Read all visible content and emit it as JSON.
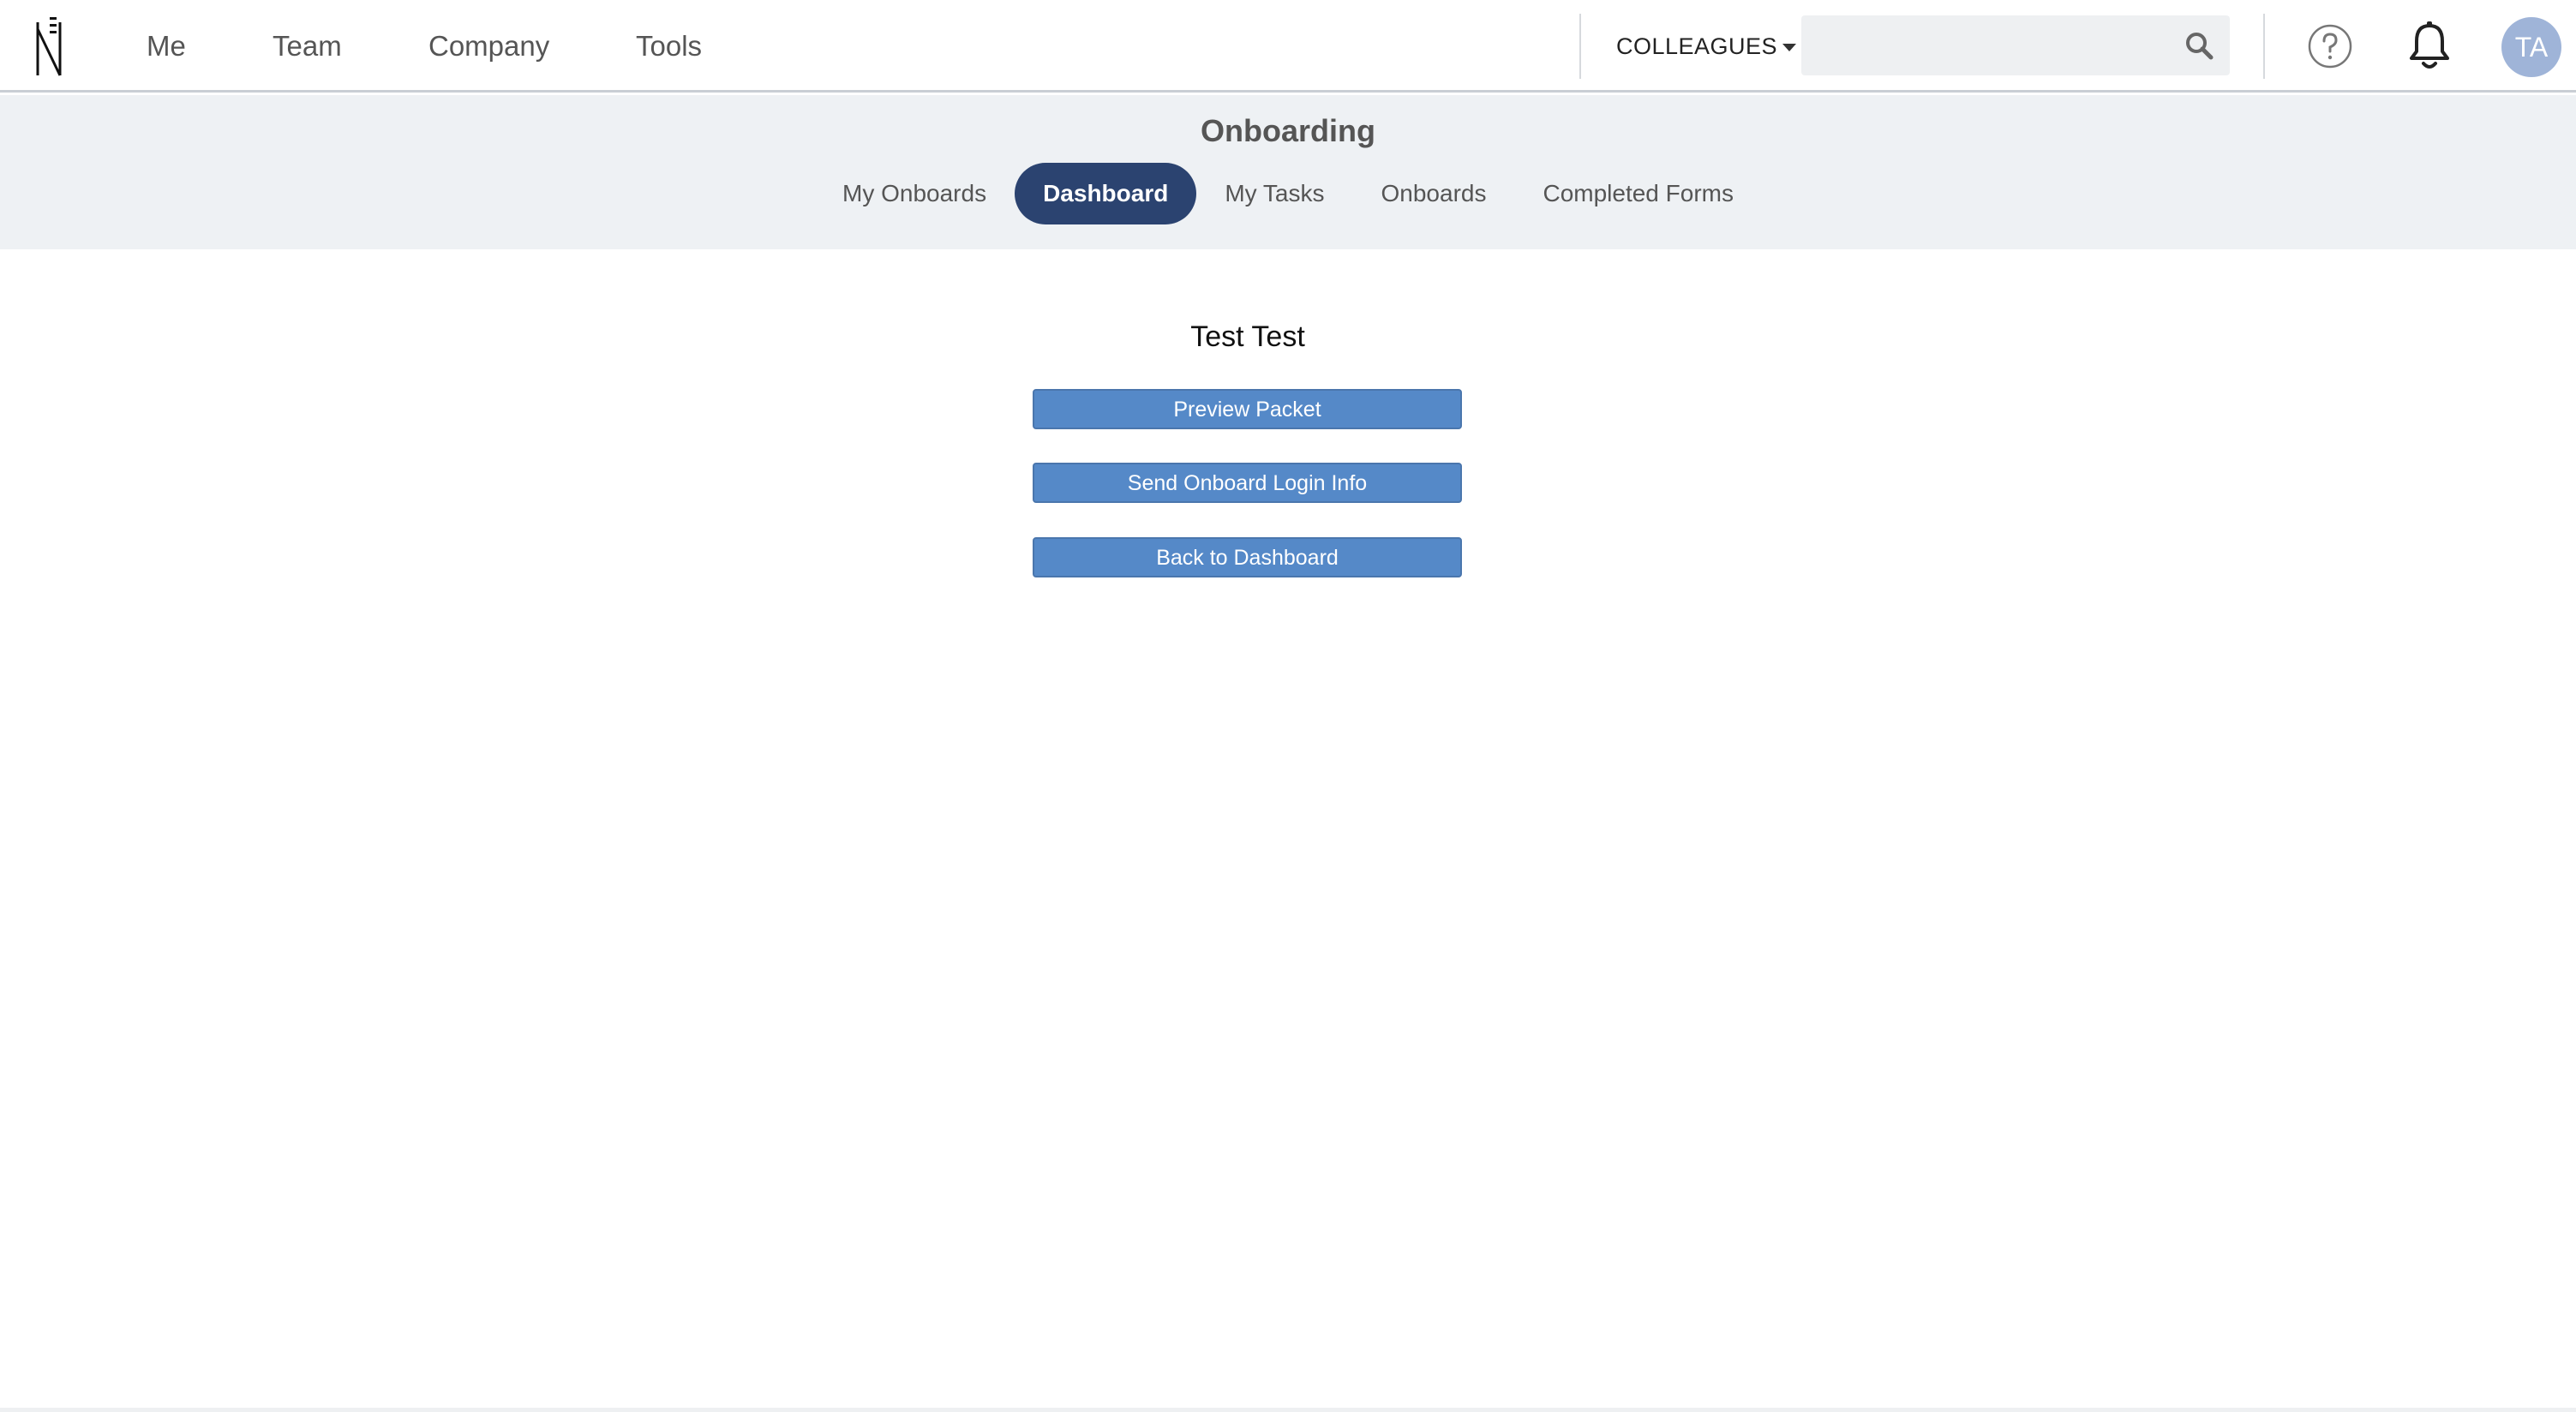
{
  "topnav": {
    "items": [
      "Me",
      "Team",
      "Company",
      "Tools"
    ],
    "colleagues_label": "COLLEAGUES",
    "search_placeholder": "",
    "avatar_initials": "TA"
  },
  "subheader": {
    "title": "Onboarding",
    "tabs": [
      {
        "label": "My Onboards",
        "active": false
      },
      {
        "label": "Dashboard",
        "active": true
      },
      {
        "label": "My Tasks",
        "active": false
      },
      {
        "label": "Onboards",
        "active": false
      },
      {
        "label": "Completed Forms",
        "active": false
      }
    ]
  },
  "main": {
    "person_name": "Test Test",
    "buttons": {
      "preview": "Preview Packet",
      "send_login": "Send Onboard Login Info",
      "back": "Back to Dashboard"
    }
  },
  "colors": {
    "active_tab": "#2b4370",
    "button": "#5589c8",
    "avatar": "#9fb4d8",
    "subheader_bg": "#eef1f4"
  },
  "icons": {
    "logo": "n-logo-icon",
    "search": "search-icon",
    "help": "help-icon",
    "notifications": "bell-icon"
  }
}
